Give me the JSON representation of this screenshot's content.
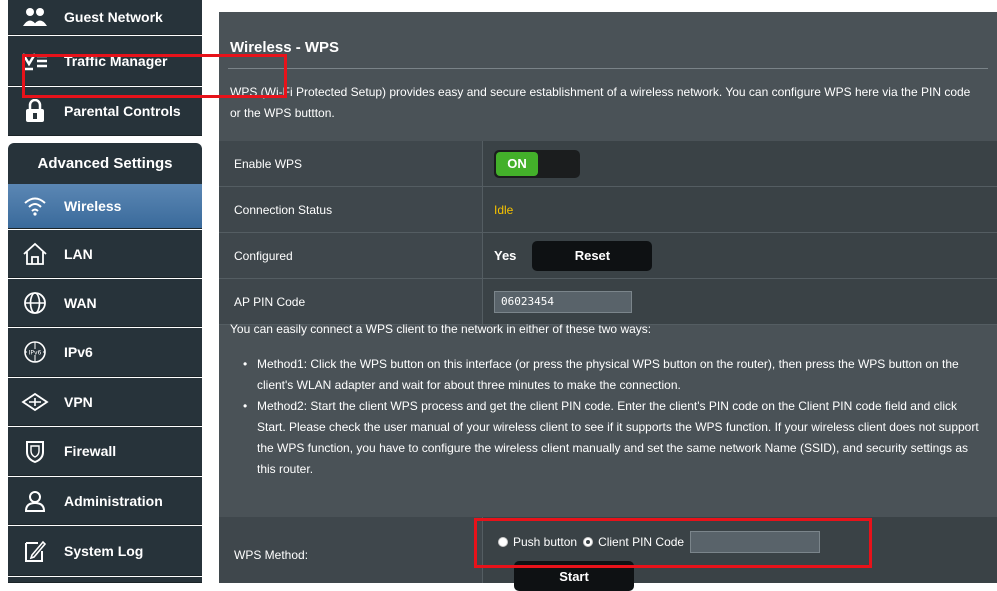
{
  "sidebar": {
    "top_items": [
      {
        "label": "Guest Network",
        "icon": "guest-network-icon"
      },
      {
        "label": "Traffic Manager",
        "icon": "traffic-manager-icon"
      },
      {
        "label": "Parental Controls",
        "icon": "parental-controls-icon"
      }
    ],
    "section_title": "Advanced Settings",
    "items": [
      {
        "label": "Wireless",
        "icon": "wifi-icon",
        "active": true
      },
      {
        "label": "LAN",
        "icon": "home-icon"
      },
      {
        "label": "WAN",
        "icon": "globe-icon"
      },
      {
        "label": "IPv6",
        "icon": "ipv6-icon"
      },
      {
        "label": "VPN",
        "icon": "vpn-icon"
      },
      {
        "label": "Firewall",
        "icon": "shield-icon"
      },
      {
        "label": "Administration",
        "icon": "admin-user-icon"
      },
      {
        "label": "System Log",
        "icon": "system-log-icon"
      }
    ]
  },
  "main": {
    "title": "Wireless - WPS",
    "description": "WPS (Wi-Fi Protected Setup) provides easy and secure establishment of a wireless network. You can configure WPS here via the PIN code or the WPS buttton.",
    "rows": {
      "enable_wps": {
        "label": "Enable WPS",
        "toggle_text": "ON"
      },
      "connection_status": {
        "label": "Connection Status",
        "value": "Idle"
      },
      "configured": {
        "label": "Configured",
        "value": "Yes",
        "button": "Reset"
      },
      "ap_pin": {
        "label": "AP PIN Code",
        "value": "06023454"
      }
    },
    "intro": "You can easily connect a WPS client to the network in either of these two ways:",
    "methods": [
      "Method1: Click the WPS button on this interface (or press the physical WPS button on the router), then press the WPS button on the client's WLAN adapter and wait for about three minutes to make the connection.",
      "Method2: Start the client WPS process and get the client PIN code. Enter the client's PIN code on the Client PIN code field and click Start. Please check the user manual of your wireless client to see if it supports the WPS function. If your wireless client does not support the WPS function, you have to configure the wireless client manually and set the same network Name (SSID), and security settings as this router."
    ],
    "wps_method": {
      "label": "WPS Method:",
      "options": [
        "Push button",
        "Client PIN Code"
      ],
      "selected": "Client PIN Code",
      "client_pin_value": "",
      "start_button": "Start"
    }
  },
  "colors": {
    "sidebar_bg": "#27333a",
    "active_item": "#4a7aa9",
    "panel_bg": "#4a5257",
    "toggle_on": "#43b02a",
    "status_idle": "#f5c100",
    "annotation_red": "#e8121a"
  }
}
